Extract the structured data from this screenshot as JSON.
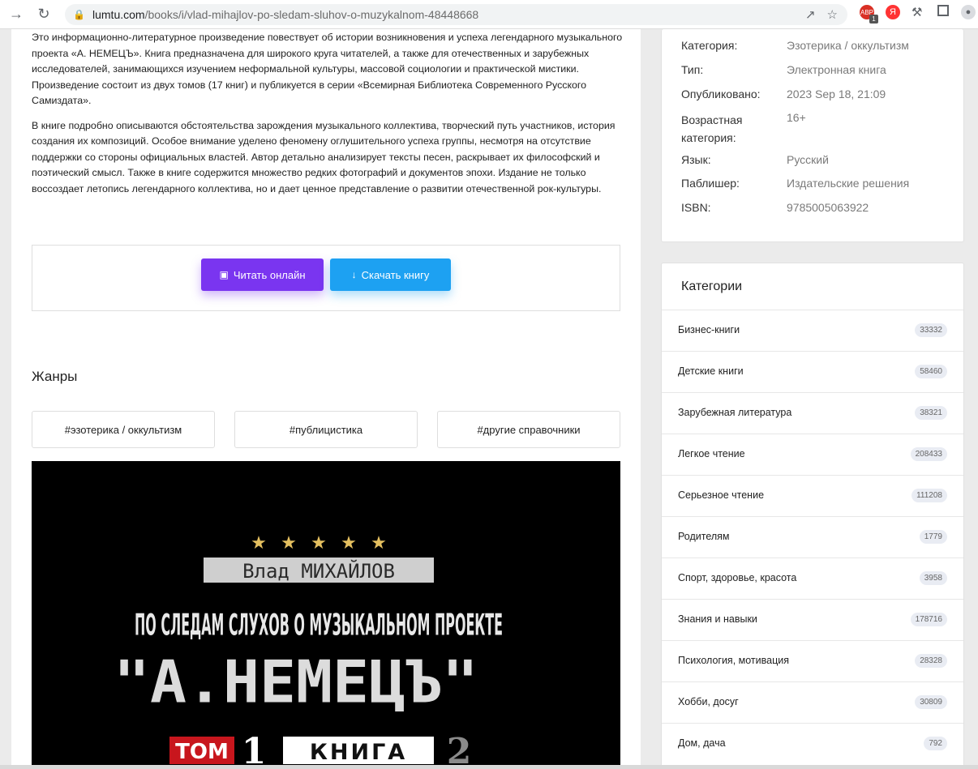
{
  "browser": {
    "url_domain": "lumtu.com",
    "url_path": "/books/i/vlad-mihajlov-po-sledam-sluhov-o-muzykalnom-48448668",
    "abp_badge": "1"
  },
  "description": {
    "p1": "Это информационно-литературное произведение повествует об истории возникновения и успеха легендарного музыкального проекта «А. НЕМЕЦЪ». Книга предназначена для широкого круга читателей, а также для отечественных и зарубежных исследователей, занимающихся изучением неформальной культуры, массовой социологии и практической мистики. Произведение состоит из двух томов (17 книг) и публикуется в серии «Всемирная Библиотека Современного Русского Самиздата».",
    "p2": "В книге подробно описываются обстоятельства зарождения музыкального коллектива, творческий путь участников, история создания их композиций. Особое внимание уделено феномену оглушительного успеха группы, несмотря на отсутствие поддержки со стороны официальных властей. Автор детально анализирует тексты песен, раскрывает их философский и поэтический смысл. Также в книге содержится множество редких фотографий и документов эпохи. Издание не только воссоздает летопись легендарного коллектива, но и дает ценное представление о развитии отечественной рок-культуры."
  },
  "buttons": {
    "read_label": "Читать онлайн",
    "download_label": "Скачать книгу"
  },
  "genres": {
    "title": "Жанры",
    "tags": [
      "#эзотерика / оккультизм",
      "#публицистика",
      "#другие справочники"
    ]
  },
  "cover": {
    "author": "Влад МИХАЙЛОВ",
    "line1": "ПО СЛЕДАМ СЛУХОВ О МУЗЫКАЛЬНОМ ПРОЕКТЕ",
    "line2": "\"А.НЕМЕЦЪ\"",
    "tom_label": "ТОМ",
    "tom_num": "1",
    "kniga_label": "КНИГА",
    "kniga_num": "2",
    "stars": 5
  },
  "meta": [
    {
      "label": "Категория:",
      "value": "Эзотерика / оккультизм"
    },
    {
      "label": "Тип:",
      "value": "Электронная книга"
    },
    {
      "label": "Опубликовано:",
      "value": "2023 Sep 18, 21:09"
    },
    {
      "label": "Возрастная категория:",
      "value": "16+"
    },
    {
      "label": "Язык:",
      "value": "Русский"
    },
    {
      "label": "Паблишер:",
      "value": "Издательские решения"
    },
    {
      "label": "ISBN:",
      "value": "9785005063922"
    }
  ],
  "categories": {
    "title": "Категории",
    "items": [
      {
        "name": "Бизнес-книги",
        "count": "33332"
      },
      {
        "name": "Детские книги",
        "count": "58460"
      },
      {
        "name": "Зарубежная литература",
        "count": "38321"
      },
      {
        "name": "Легкое чтение",
        "count": "208433"
      },
      {
        "name": "Серьезное чтение",
        "count": "111208"
      },
      {
        "name": "Родителям",
        "count": "1779"
      },
      {
        "name": "Спорт, здоровье, красота",
        "count": "3958"
      },
      {
        "name": "Знания и навыки",
        "count": "178716"
      },
      {
        "name": "Психология, мотивация",
        "count": "28328"
      },
      {
        "name": "Хобби, досуг",
        "count": "30809"
      },
      {
        "name": "Дом, дача",
        "count": "792"
      }
    ]
  }
}
